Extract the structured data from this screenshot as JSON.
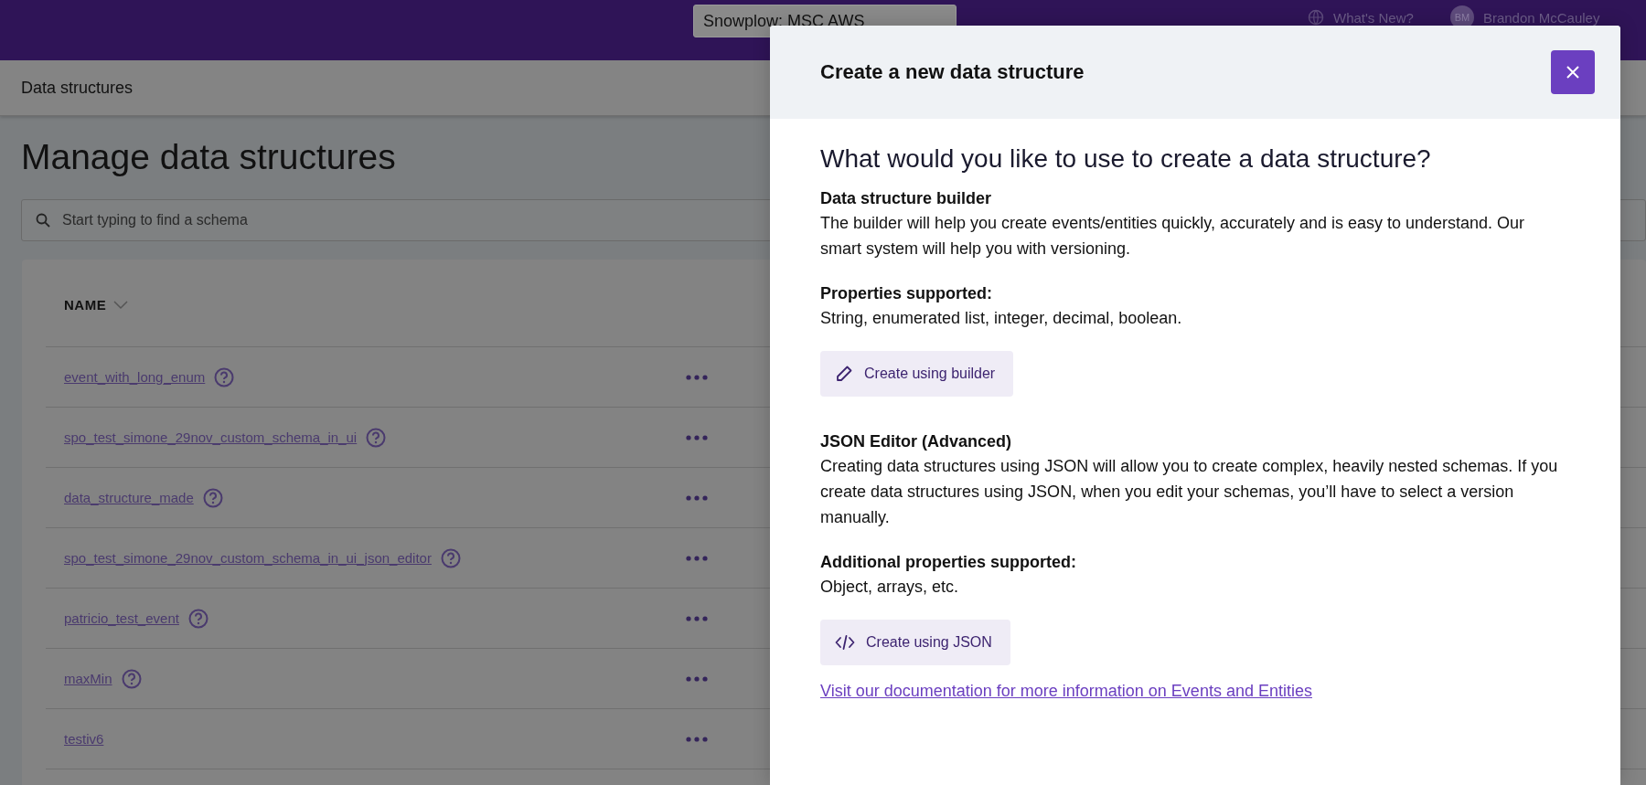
{
  "top_bar": {
    "workspace_selector": "Snowplow: MSC AWS",
    "whats_new": "What's New?",
    "user_initials": "BM",
    "user_name": "Brandon McCauley"
  },
  "breadcrumb": "Data structures",
  "page_title": "Manage data structures",
  "search": {
    "placeholder": "Start typing to find a schema"
  },
  "table": {
    "columns": [
      {
        "label": "NAME"
      }
    ],
    "rows": [
      {
        "name": "event_with_long_enum",
        "help": true
      },
      {
        "name": "spo_test_simone_29nov_custom_schema_in_ui",
        "help": true
      },
      {
        "name": "data_structure_made",
        "help": true
      },
      {
        "name": "spo_test_simone_29nov_custom_schema_in_ui_json_editor",
        "help": true
      },
      {
        "name": "patricio_test_event",
        "help": true
      },
      {
        "name": "maxMin",
        "help": true
      },
      {
        "name": "testiv6",
        "help": false
      }
    ]
  },
  "modal": {
    "title": "Create a new data structure",
    "heading": "What would you like to use to create a data structure?",
    "sections": [
      {
        "title": "Data structure builder",
        "text": "The builder will help you create events/entities quickly, accurately and is easy to understand. Our smart system will help you with versioning.",
        "subtitle": "Properties supported:",
        "subtext": "String, enumerated list, integer, decimal, boolean.",
        "button": {
          "kind": "builder",
          "label": "Create using builder"
        }
      },
      {
        "title": "JSON Editor (Advanced)",
        "text": "Creating data structures using JSON will allow you to create complex, heavily nested schemas. If you create data structures using JSON, when you edit your schemas, you’ll have to select a version manually.",
        "subtitle": "Additional properties supported:",
        "subtext": "Object, arrays, etc.",
        "button": {
          "kind": "json",
          "label": "Create using JSON"
        }
      }
    ],
    "link": "Visit our documentation for more information on Events and Entities"
  }
}
